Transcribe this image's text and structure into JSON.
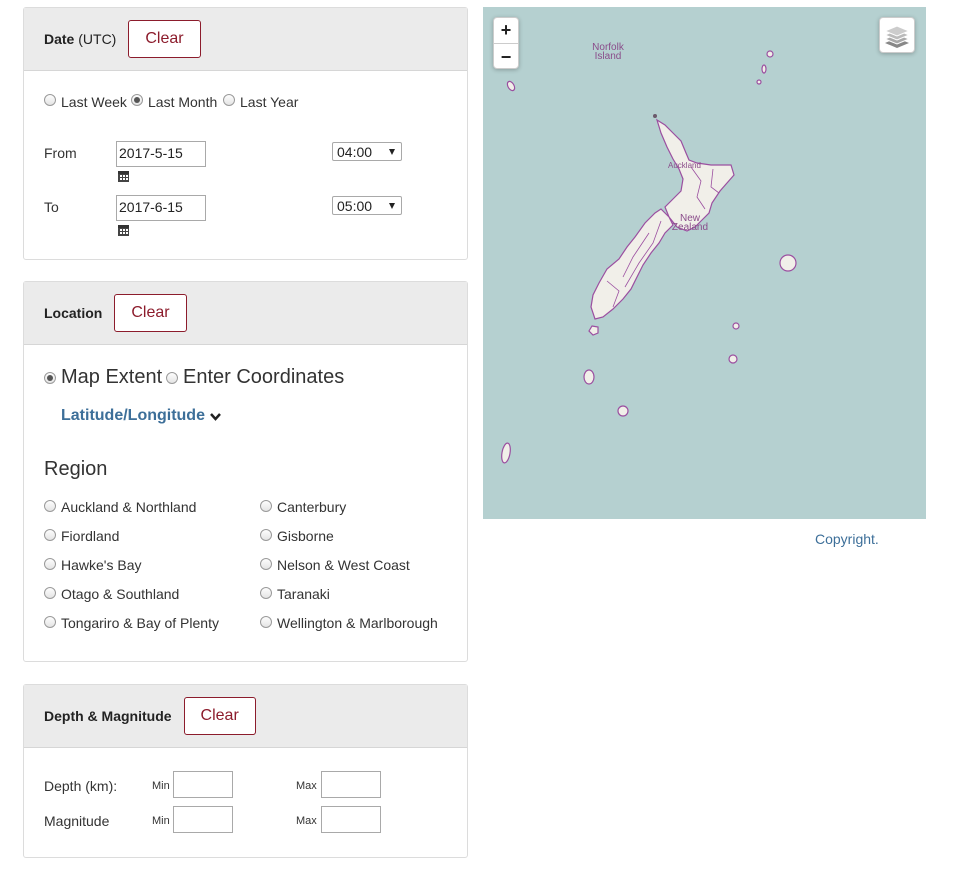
{
  "date": {
    "title": "Date",
    "title_suffix": "(UTC)",
    "clear_label": "Clear",
    "ranges": [
      "Last Week",
      "Last Month",
      "Last Year"
    ],
    "selected_range": "Last Month",
    "from_label": "From",
    "from_date": "2017-5-15",
    "from_time": "04:00",
    "to_label": "To",
    "to_date": "2017-6-15",
    "to_time": "05:00"
  },
  "location": {
    "title": "Location",
    "clear_label": "Clear",
    "modes": [
      "Map Extent",
      "Enter Coordinates"
    ],
    "selected_mode": "Map Extent",
    "latlon_label": "Latitude/Longitude",
    "region_heading": "Region",
    "regions": [
      "Auckland & Northland",
      "Canterbury",
      "Fiordland",
      "Gisborne",
      "Hawke's Bay",
      "Nelson & West Coast",
      "Otago & Southland",
      "Taranaki",
      "Tongariro & Bay of Plenty",
      "Wellington & Marlborough"
    ]
  },
  "depth_magnitude": {
    "title": "Depth & Magnitude",
    "clear_label": "Clear",
    "depth_label": "Depth (km):",
    "magnitude_label": "Magnitude",
    "min_label": "Min",
    "max_label": "Max"
  },
  "map": {
    "zoom_in": "+",
    "zoom_out": "−",
    "labels": {
      "norfolk": "Norfolk Island",
      "auckland": "Auckland",
      "new_zealand": "New Zealand"
    },
    "copyright": "Copyright."
  },
  "icons": {
    "calendar": "calendar-icon",
    "chevron": "chevron-down-icon",
    "layers": "layers-icon"
  },
  "colors": {
    "accent": "#8c1c2c",
    "link": "#3d6f99",
    "sea": "#b5d0d0",
    "land": "#f1efe9",
    "boundary": "#9b4fa0"
  }
}
